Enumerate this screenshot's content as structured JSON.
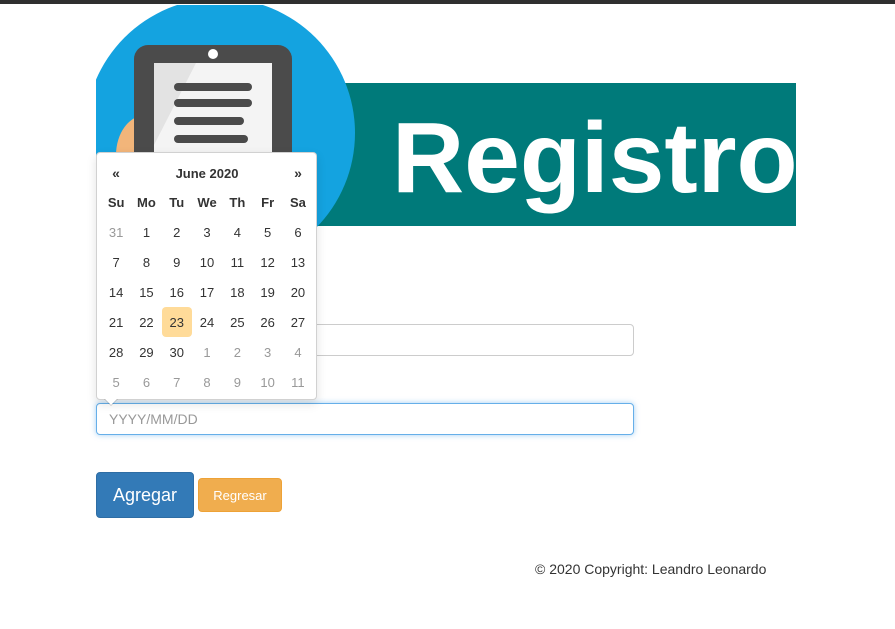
{
  "banner": {
    "title": "Registro",
    "icon": "notepad-icon"
  },
  "form": {
    "field1": {
      "value": "",
      "placeholder": ""
    },
    "date": {
      "value": "",
      "placeholder": "YYYY/MM/DD"
    },
    "buttons": {
      "add": "Agregar",
      "back": "Regresar"
    }
  },
  "datepicker": {
    "prev": "«",
    "next": "»",
    "month": "June 2020",
    "weekdays": [
      "Su",
      "Mo",
      "Tu",
      "We",
      "Th",
      "Fr",
      "Sa"
    ],
    "days": [
      [
        "31",
        "1",
        "2",
        "3",
        "4",
        "5",
        "6"
      ],
      [
        "7",
        "8",
        "9",
        "10",
        "11",
        "12",
        "13"
      ],
      [
        "14",
        "15",
        "16",
        "17",
        "18",
        "19",
        "20"
      ],
      [
        "21",
        "22",
        "23",
        "24",
        "25",
        "26",
        "27"
      ],
      [
        "28",
        "29",
        "30",
        "1",
        "2",
        "3",
        "4"
      ],
      [
        "5",
        "6",
        "7",
        "8",
        "9",
        "10",
        "11"
      ]
    ],
    "today": "23"
  },
  "footer": {
    "text": "© 2020 Copyright: Leandro Leonardo"
  },
  "colors": {
    "teal": "#007a7a",
    "circle": "#14a3e0",
    "primary": "#337ab7",
    "warning": "#f0ad4e",
    "today": "#ffdb99"
  }
}
